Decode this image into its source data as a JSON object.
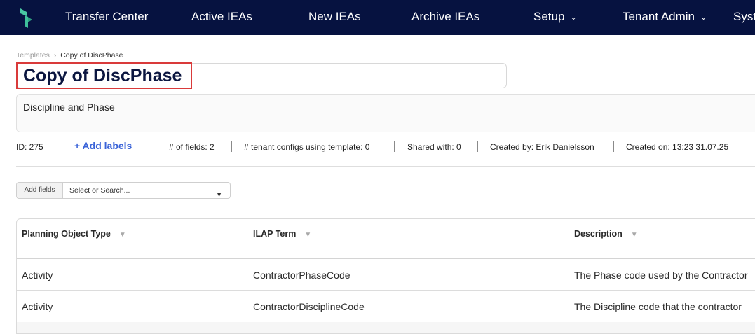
{
  "nav": {
    "items": [
      {
        "label": "Transfer Center",
        "has_dropdown": false
      },
      {
        "label": "Active IEAs",
        "has_dropdown": false
      },
      {
        "label": "New IEAs",
        "has_dropdown": false
      },
      {
        "label": "Archive IEAs",
        "has_dropdown": false
      },
      {
        "label": "Setup",
        "has_dropdown": true
      },
      {
        "label": "Tenant Admin",
        "has_dropdown": true
      },
      {
        "label": "Syst",
        "has_dropdown": false
      }
    ],
    "background": "#061240",
    "logo_color": "#3fbf9a"
  },
  "breadcrumb": {
    "parent": "Templates",
    "current": "Copy of DiscPhase"
  },
  "template": {
    "title": "Copy of DiscPhase",
    "description": "Discipline and Phase"
  },
  "meta": {
    "id": "ID: 275",
    "add_labels": "+ Add labels",
    "fields_count": "# of fields: 2",
    "tenant_configs": "# tenant configs using template: 0",
    "shared_with": "Shared with: 0",
    "created_by": "Created by: Erik Danielsson",
    "created_on": "Created on: 13:23 31.07.25"
  },
  "add_fields": {
    "label": "Add fields",
    "placeholder": "Select or Search..."
  },
  "table": {
    "columns": [
      "Planning Object Type",
      "ILAP Term",
      "Description"
    ],
    "rows": [
      [
        "Activity",
        "ContractorPhaseCode",
        "The Phase code used by the Contractor"
      ],
      [
        "Activity",
        "ContractorDisciplineCode",
        "The Discipline code that the contractor"
      ]
    ]
  },
  "colors": {
    "highlight": "#d93a3a",
    "link": "#3b64d8",
    "title": "#0b1640"
  }
}
